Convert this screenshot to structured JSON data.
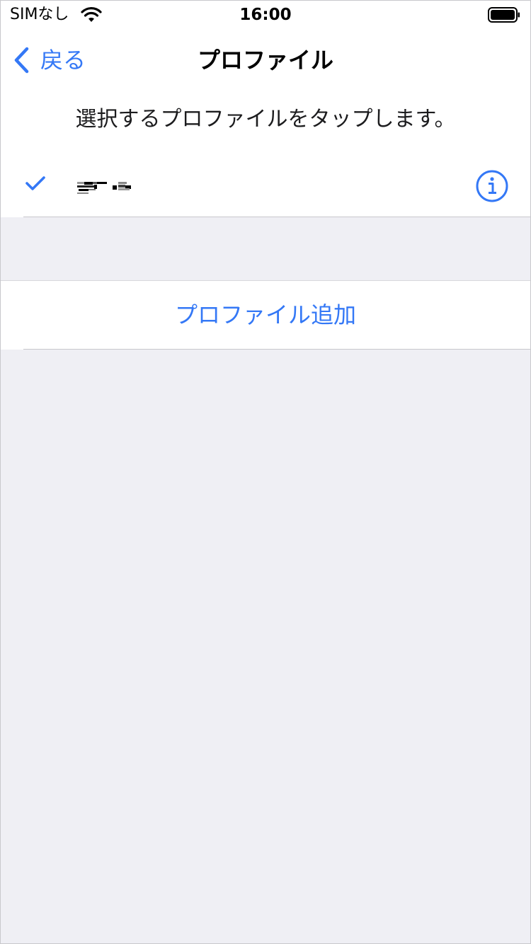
{
  "status_bar": {
    "carrier": "SIMなし",
    "time": "16:00",
    "wifi_icon": "wifi-icon",
    "battery_icon": "battery-icon"
  },
  "nav": {
    "back_label": "戻る",
    "back_icon": "chevron-left-icon",
    "title": "プロファイル"
  },
  "content": {
    "instruction": "選択するプロファイルをタップします。",
    "profiles": [
      {
        "selected": true,
        "check_icon": "checkmark-icon",
        "info_icon": "info-circle-icon"
      }
    ],
    "add_profile_label": "プロファイル追加"
  },
  "colors": {
    "accent": "#3478f6",
    "background": "#efeff4",
    "cell": "#ffffff",
    "separator": "#c8c7cc"
  }
}
